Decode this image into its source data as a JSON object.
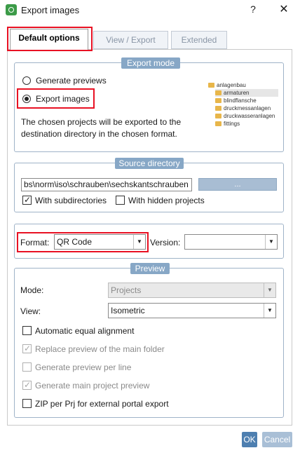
{
  "window": {
    "title": "Export images",
    "help": "?",
    "close": "✕"
  },
  "tabs": [
    {
      "label": "Default options"
    },
    {
      "label": "View / Export"
    },
    {
      "label": "Extended"
    }
  ],
  "export_mode": {
    "legend": "Export mode",
    "option_previews": "Generate previews",
    "option_images": "Export images",
    "description": "The chosen projects will be exported to the destination directory in the chosen format.",
    "tree": [
      "anlagenbau",
      "armaturen",
      "blindflansche",
      "druckmessanlagen",
      "druckwasseranlagen",
      "fittings"
    ]
  },
  "source": {
    "legend": "Source directory",
    "path": "bs\\norm\\iso\\schrauben\\sechskantschrauben",
    "browse": "...",
    "with_subdirs": "With subdirectories",
    "with_hidden": "With hidden projects"
  },
  "format": {
    "label": "Format:",
    "value": "QR Code",
    "version_label": "Version:",
    "version_value": ""
  },
  "preview": {
    "legend": "Preview",
    "mode_label": "Mode:",
    "mode_value": "Projects",
    "view_label": "View:",
    "view_value": "Isometric",
    "auto_align": "Automatic equal alignment",
    "replace_main": "Replace preview of the main folder",
    "per_line": "Generate preview per line",
    "main_project": "Generate main project preview",
    "zip": "ZIP per Prj for external portal export"
  },
  "footer": {
    "ok": "OK",
    "cancel": "Cancel"
  },
  "colors": {
    "highlight": "#e81123",
    "legend_bg": "#87a7c6",
    "primary": "#4e7fb0"
  }
}
